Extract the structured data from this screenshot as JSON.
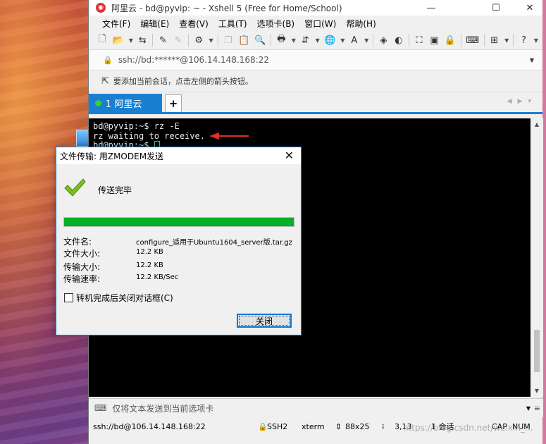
{
  "window": {
    "title": "阿里云 - bd@pyvip: ~ - Xshell 5 (Free for Home/School)",
    "controls": {
      "minimize": "—",
      "maximize": "☐",
      "close": "✕"
    }
  },
  "menu": [
    "文件(F)",
    "编辑(E)",
    "查看(V)",
    "工具(T)",
    "选项卡(B)",
    "窗口(W)",
    "帮助(H)"
  ],
  "address": {
    "text": "ssh://bd:******@106.14.148.168:22"
  },
  "hint": {
    "text": "要添加当前会话，点击左侧的箭头按钮。"
  },
  "tabs": {
    "active_label": "1 阿里云",
    "add_label": "+"
  },
  "terminal": {
    "lines": [
      "bd@pyvip:~$ rz -E",
      "rz waiting to receive.",
      "bd@pyvip:~$ "
    ]
  },
  "sendbar": {
    "placeholder": "仅将文本发送到当前选项卡"
  },
  "status": {
    "connection": "ssh://bd@106.14.148.168:22",
    "protocol": "SSH2",
    "terminal": "xterm",
    "size": "88x25",
    "position": "3,13",
    "sessions": "1 会话",
    "cap": "CAP",
    "num": "NUM"
  },
  "watermark": "https://blog.csdn.net/weixin_...",
  "dialog": {
    "title": "文件传输: 用ZMODEM发送",
    "status": "传送完毕",
    "progress": 1.0,
    "labels": {
      "filename": "文件名:",
      "filesize": "文件大小:",
      "transferred": "传输大小:",
      "speed": "传输速率:"
    },
    "values": {
      "filename": "configure_适用于Ubuntu1604_server版.tar.gz",
      "filesize": "12.2 KB",
      "transferred": "12.2 KB",
      "speed": "12.2 KB/Sec"
    },
    "checkbox_label": "转机完成后关闭对话框(C)",
    "close_button": "关闭"
  },
  "colors": {
    "accent": "#1b7fd0",
    "progress": "#06b025",
    "check": "#7cc11e"
  }
}
